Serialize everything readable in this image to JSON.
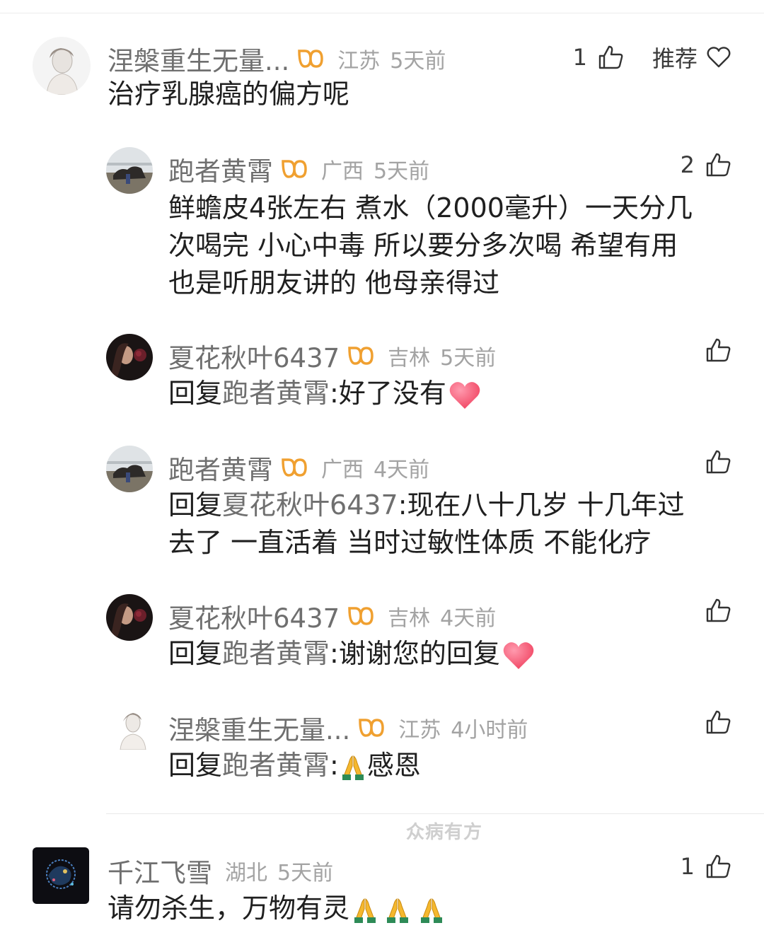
{
  "comments": [
    {
      "name": "涅槃重生无量...",
      "location": "江苏",
      "time": "5天前",
      "likes": "1",
      "recommend_label": "推荐",
      "text": "治疗乳腺癌的偏方呢"
    },
    {
      "name": "跑者黄霄",
      "location": "广西",
      "time": "5天前",
      "likes": "2",
      "lines": [
        "鲜蟾皮4张左右 煮水（2000毫升）一天分几",
        "次喝完  小心中毒 所以要分多次喝  希望有用",
        "也是听朋友讲的 他母亲得过"
      ]
    },
    {
      "name": "夏花秋叶6437",
      "location": "吉林",
      "time": "5天前",
      "reply_prefix": "回复",
      "reply_to": "跑者黄霄",
      "text": ":好了没有"
    },
    {
      "name": "跑者黄霄",
      "location": "广西",
      "time": "4天前",
      "reply_prefix": "回复",
      "reply_to": "夏花秋叶6437",
      "text": ":现在八十几岁  十几年过",
      "line2": "去了 一直活着 当时过敏性体质 不能化疗"
    },
    {
      "name": "夏花秋叶6437",
      "location": "吉林",
      "time": "4天前",
      "reply_prefix": "回复",
      "reply_to": "跑者黄霄",
      "text": ":谢谢您的回复"
    },
    {
      "name": "涅槃重生无量...",
      "location": "江苏",
      "time": "4小时前",
      "reply_prefix": "回复",
      "reply_to": "跑者黄霄",
      "text": "感恩"
    },
    {
      "name": "千江飞雪",
      "location": "湖北",
      "time": "5天前",
      "likes": "1",
      "text": "请勿杀生，万物有灵"
    }
  ],
  "watermark": "众病有方",
  "colors": {
    "vip_badge": "#f0a030",
    "heart": "#ff5577",
    "pray": "#f5b82e"
  },
  "icons": [
    "like-icon",
    "heart-outline-icon",
    "vip-badge-icon",
    "heart-emoji",
    "pray-emoji"
  ]
}
